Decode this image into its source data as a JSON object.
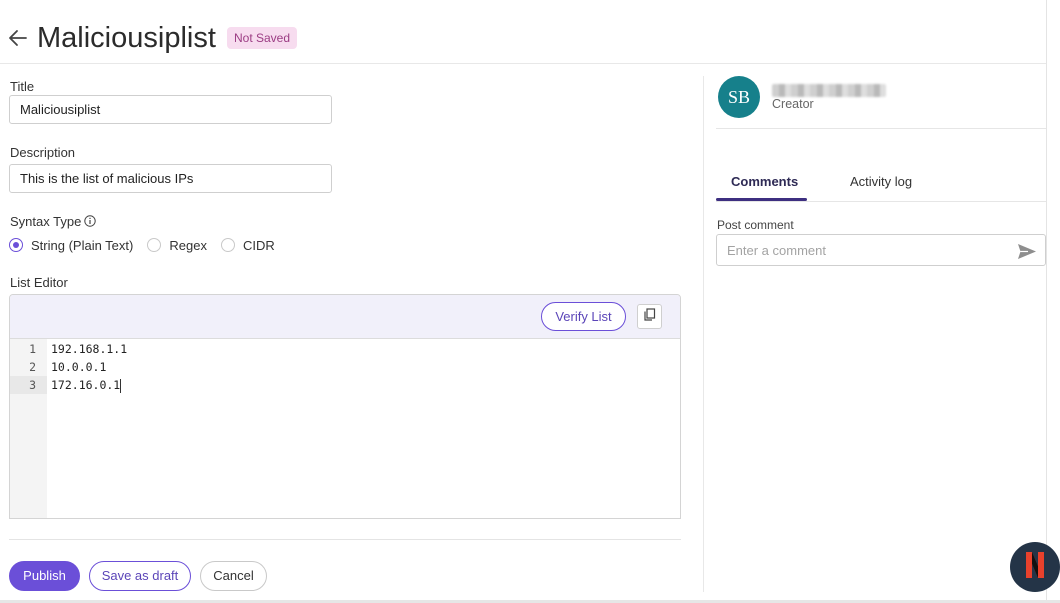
{
  "header": {
    "title": "Maliciousiplist",
    "status_badge": "Not Saved"
  },
  "form": {
    "title_label": "Title",
    "title_value": "Maliciousiplist",
    "description_label": "Description",
    "description_value": "This is the list of malicious IPs",
    "syntax_label": "Syntax Type",
    "syntax_options": [
      {
        "label": "String (Plain Text)",
        "checked": true
      },
      {
        "label": "Regex",
        "checked": false
      },
      {
        "label": "CIDR",
        "checked": false
      }
    ],
    "editor_label": "List Editor",
    "verify_label": "Verify List",
    "lines": [
      {
        "num": "1",
        "text": "192.168.1.1"
      },
      {
        "num": "2",
        "text": "10.0.0.1"
      },
      {
        "num": "3",
        "text": "172.16.0.1"
      }
    ]
  },
  "actions": {
    "publish": "Publish",
    "save_draft": "Save as draft",
    "cancel": "Cancel"
  },
  "sidebar": {
    "avatar_initials": "SB",
    "creator_role": "Creator",
    "tabs": [
      "Comments",
      "Activity log"
    ],
    "active_tab": "Comments",
    "post_comment_label": "Post comment",
    "comment_placeholder": "Enter a comment"
  },
  "colors": {
    "accent": "#6b4fd8",
    "avatar_bg": "#16808b",
    "badge_bg": "#f7dcef",
    "badge_text": "#9c3d84",
    "fab_bg": "#243447",
    "fab_mark": "#e8412c"
  },
  "icons": [
    "back-arrow-icon",
    "info-icon",
    "copy-icon",
    "send-icon",
    "brand-logo-icon"
  ]
}
